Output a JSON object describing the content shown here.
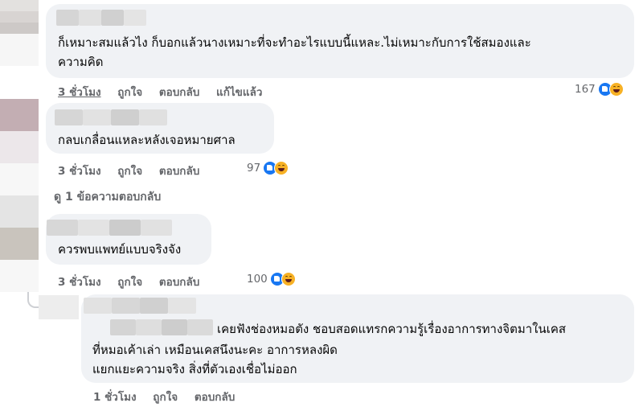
{
  "comments": [
    {
      "text_lines": [
        "ก็เหมาะสมแล้วไง ก็บอกแล้วนางเหมาะที่จะทำอะไรแบบนี้แหละ.ไม่เหมาะกับการใช้สมองและ",
        "ความคิด"
      ],
      "time": "3 ชั่วโมง",
      "like_label": "ถูกใจ",
      "reply_label": "ตอบกลับ",
      "edited_label": "แก้ไขแล้ว",
      "reaction_count": "167"
    },
    {
      "text_lines": [
        "กลบเกลื่อนแหละหลังเจอหมายศาล"
      ],
      "time": "3 ชั่วโมง",
      "like_label": "ถูกใจ",
      "reply_label": "ตอบกลับ",
      "reaction_count": "97",
      "view_replies": "ดู 1 ข้อความตอบกลับ"
    },
    {
      "text_lines": [
        "ควรพบแพทย์แบบจริงจัง"
      ],
      "time": "3 ชั่วโมง",
      "like_label": "ถูกใจ",
      "reply_label": "ตอบกลับ",
      "reaction_count": "100"
    },
    {
      "text_lines": [
        "เคยฟังช่องหมอตัง ชอบสอดแทรกความรู้เรื่องอาการทางจิตมาในเคส",
        "ที่หมอเค้าเล่า เหมือนเคสนึงนะคะ อาการหลงผิด",
        "แยกแยะความจริง สิ่งที่ตัวเองเชื่อไม่ออก"
      ],
      "time": "1 ชั่วโมง",
      "like_label": "ถูกใจ",
      "reply_label": "ตอบกลับ"
    }
  ],
  "icons": {
    "reaction_like": "like-icon",
    "reaction_haha": "haha-icon"
  },
  "colors": {
    "bubble": "#f0f2f5",
    "meta_text": "#65676b",
    "like_blue": "#1877f2",
    "haha_yellow": "#f7b125"
  }
}
